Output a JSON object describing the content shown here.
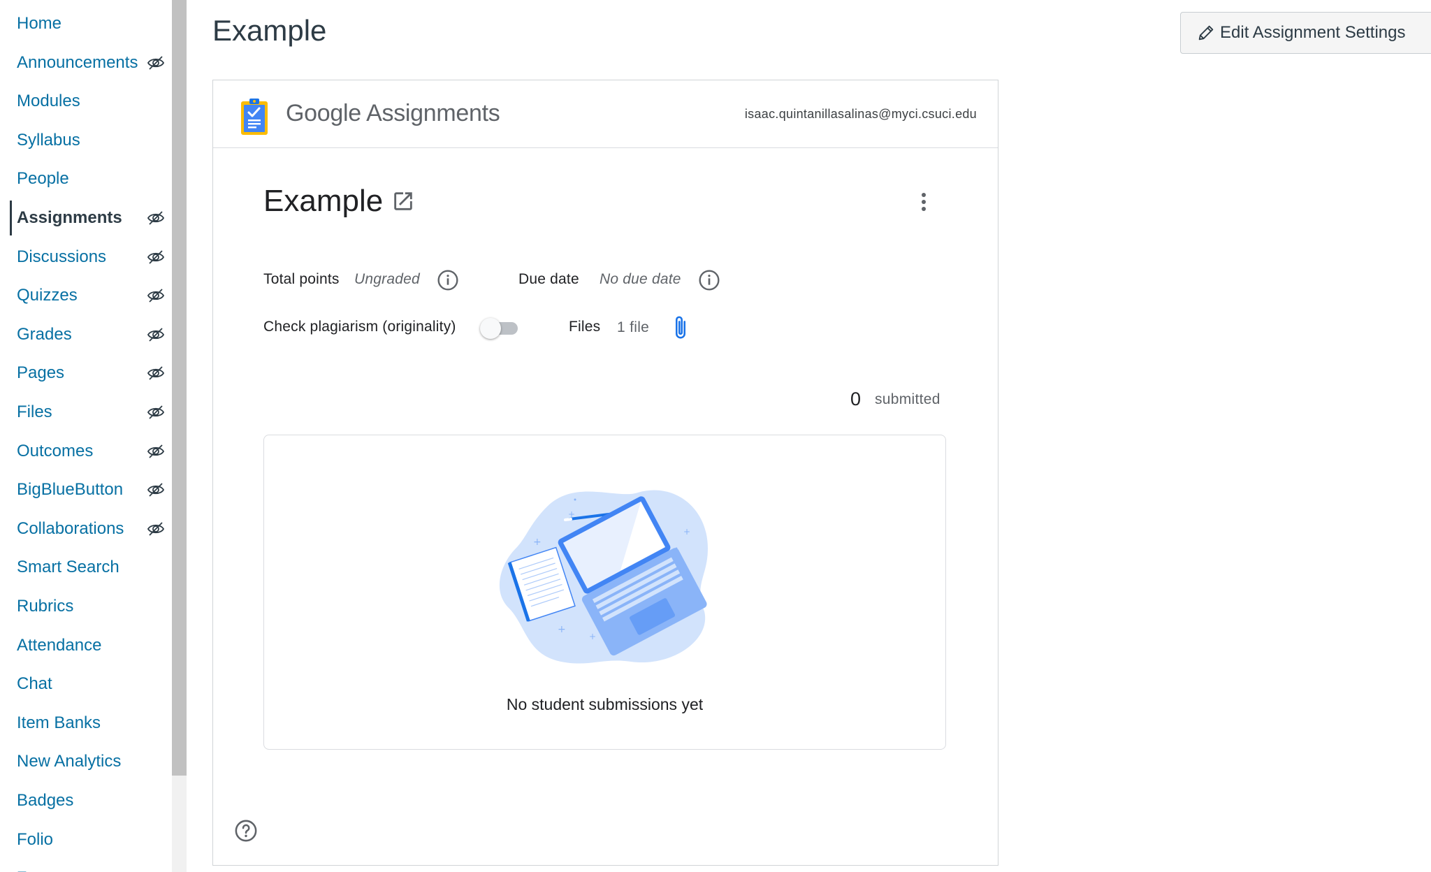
{
  "sidebar": {
    "items": [
      {
        "label": "Home",
        "hidden": false,
        "active": false
      },
      {
        "label": "Announcements",
        "hidden": true,
        "active": false
      },
      {
        "label": "Modules",
        "hidden": false,
        "active": false
      },
      {
        "label": "Syllabus",
        "hidden": false,
        "active": false
      },
      {
        "label": "People",
        "hidden": false,
        "active": false
      },
      {
        "label": "Assignments",
        "hidden": true,
        "active": true
      },
      {
        "label": "Discussions",
        "hidden": true,
        "active": false
      },
      {
        "label": "Quizzes",
        "hidden": true,
        "active": false
      },
      {
        "label": "Grades",
        "hidden": true,
        "active": false
      },
      {
        "label": "Pages",
        "hidden": true,
        "active": false
      },
      {
        "label": "Files",
        "hidden": true,
        "active": false
      },
      {
        "label": "Outcomes",
        "hidden": true,
        "active": false
      },
      {
        "label": "BigBlueButton",
        "hidden": true,
        "active": false
      },
      {
        "label": "Collaborations",
        "hidden": true,
        "active": false
      },
      {
        "label": "Smart Search",
        "hidden": false,
        "active": false
      },
      {
        "label": "Rubrics",
        "hidden": false,
        "active": false
      },
      {
        "label": "Attendance",
        "hidden": false,
        "active": false
      },
      {
        "label": "Chat",
        "hidden": false,
        "active": false
      },
      {
        "label": "Item Banks",
        "hidden": false,
        "active": false
      },
      {
        "label": "New Analytics",
        "hidden": false,
        "active": false
      },
      {
        "label": "Badges",
        "hidden": false,
        "active": false
      },
      {
        "label": "Folio",
        "hidden": false,
        "active": false
      },
      {
        "label": "Zoom",
        "hidden": false,
        "active": false
      }
    ],
    "hidden_icon": "eye-slash-icon"
  },
  "page": {
    "title": "Example",
    "edit_button_label": "Edit Assignment Settings",
    "edit_button_icon": "pencil-icon"
  },
  "google_assignments": {
    "brand_google": "Google",
    "brand_product": "Assignments",
    "user_email": "isaac.quintanillasalinas@myci.csuci.edu",
    "assignment_title": "Example",
    "total_points_label": "Total points",
    "total_points_value": "Ungraded",
    "due_date_label": "Due date",
    "due_date_value": "No due date",
    "plagiarism_label": "Check plagiarism (originality)",
    "plagiarism_enabled": false,
    "files_label": "Files",
    "files_value": "1 file",
    "submitted_count": "0",
    "submitted_label": "submitted",
    "empty_message": "No student submissions yet"
  },
  "colors": {
    "nav_link": "#0770a3",
    "text_dark": "#2d3b45",
    "google_blue": "#1a73e8",
    "logo_yellow": "#fbbc04"
  }
}
